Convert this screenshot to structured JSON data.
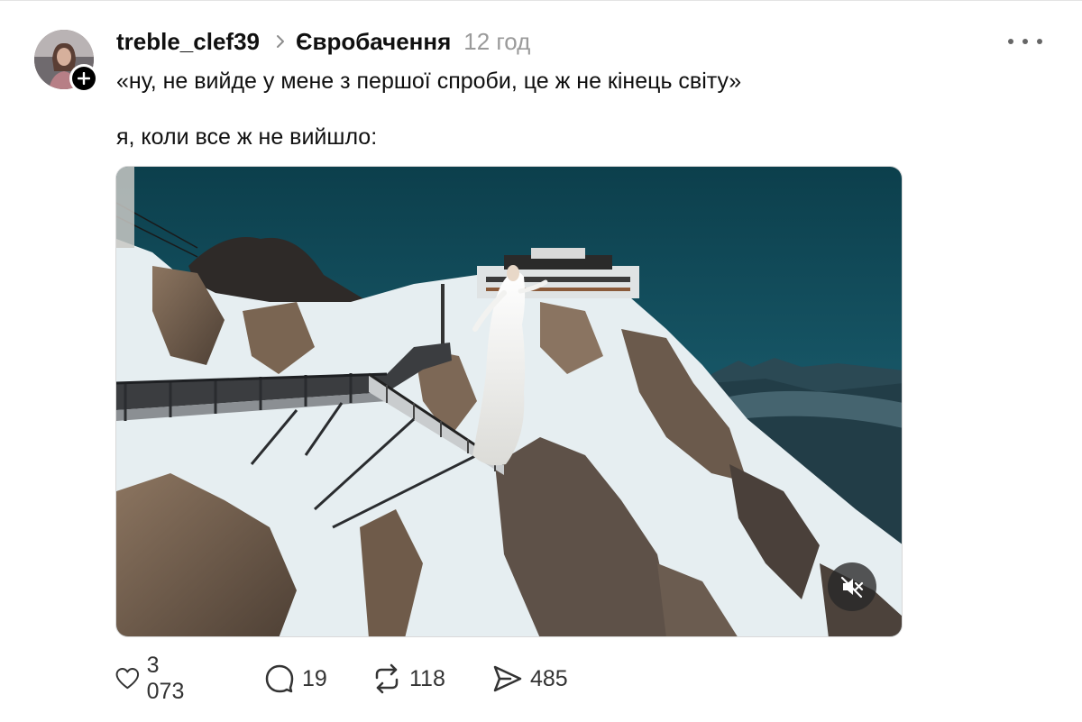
{
  "post": {
    "username": "treble_clef39",
    "community": "Євробачення",
    "time": "12 год",
    "text_line1": "«ну, не вийде у мене з першої спроби, це ж не кінець світу»",
    "text_line2": "я, коли все ж не вийшло:"
  },
  "icons": {
    "avatar": "profile-photo",
    "follow": "plus-icon",
    "chevron": "chevron-right-icon",
    "more": "more-dots-icon",
    "mute": "muted-speaker-icon",
    "like": "heart-icon",
    "comment": "comment-bubble-icon",
    "repost": "repost-arrows-icon",
    "share": "send-icon"
  },
  "media": {
    "type": "video",
    "muted": true
  },
  "actions": {
    "likes": "3 073",
    "comments": "19",
    "reposts": "118",
    "shares": "485"
  },
  "colors": {
    "text": "#101010",
    "muted_text": "#9a9a9a",
    "sky": "#0f4a5a",
    "snow": "#e8eef0"
  }
}
